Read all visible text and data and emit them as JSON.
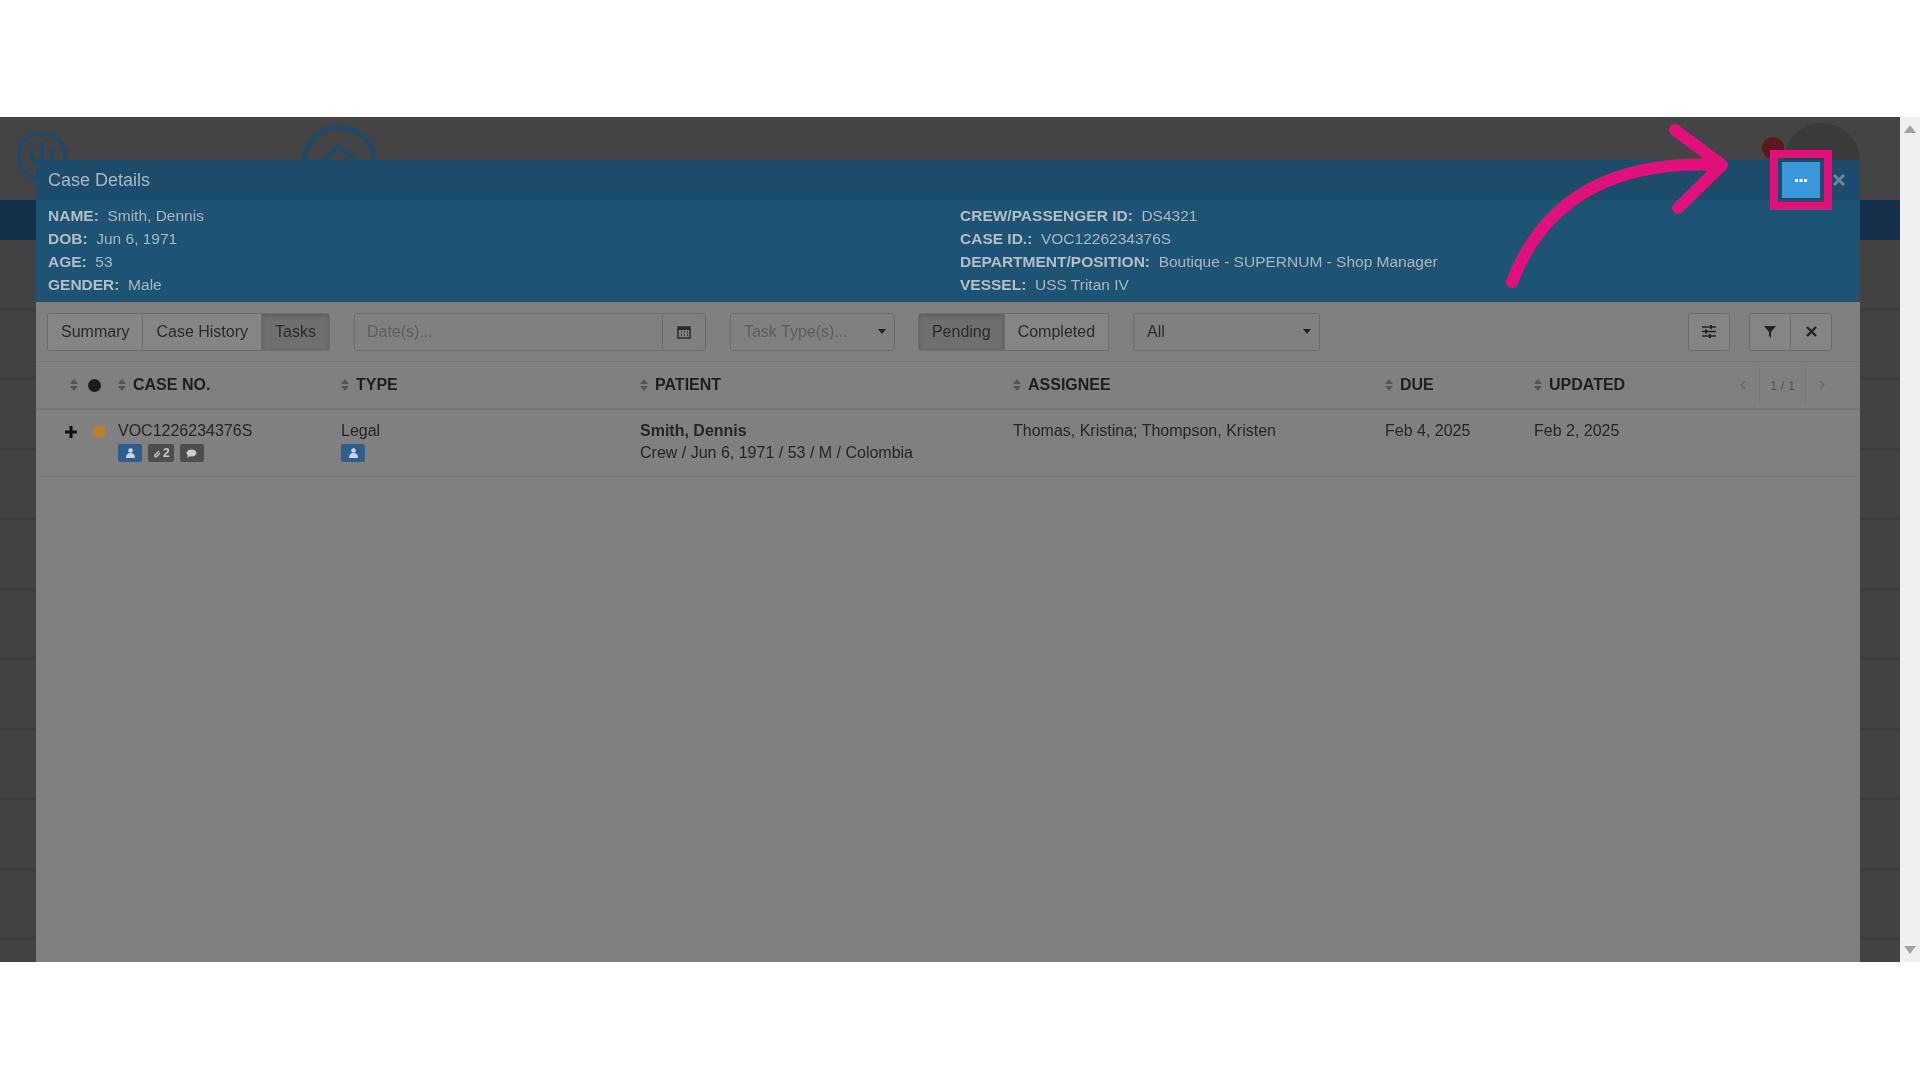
{
  "modal": {
    "title": "Case Details",
    "fields_left": [
      {
        "label": "NAME:",
        "value": "Smith, Dennis"
      },
      {
        "label": "DOB:",
        "value": "Jun 6, 1971"
      },
      {
        "label": "AGE:",
        "value": "53"
      },
      {
        "label": "GENDER:",
        "value": "Male"
      }
    ],
    "fields_right": [
      {
        "label": "CREW/PASSENGER ID:",
        "value": "DS4321"
      },
      {
        "label": "CASE ID.:",
        "value": "VOC1226234376S"
      },
      {
        "label": "DEPARTMENT/POSITION:",
        "value": "Boutique - SUPERNUM - Shop Manager"
      },
      {
        "label": "VESSEL:",
        "value": "USS Tritan IV"
      }
    ]
  },
  "view_tabs": [
    {
      "label": "Summary",
      "selected": false
    },
    {
      "label": "Case History",
      "selected": false
    },
    {
      "label": "Tasks",
      "selected": true
    }
  ],
  "date_filter": {
    "placeholder": "Date(s)..."
  },
  "task_type_filter": {
    "placeholder": "Task Type(s)..."
  },
  "status_tabs": [
    {
      "label": "Pending",
      "selected": true
    },
    {
      "label": "Completed",
      "selected": false
    }
  ],
  "assignee_filter": {
    "value": "All"
  },
  "pagination": "1 / 1",
  "table": {
    "columns": [
      "CASE NO.",
      "TYPE",
      "PATIENT",
      "ASSIGNEE",
      "DUE",
      "UPDATED"
    ],
    "rows": [
      {
        "case_no": "VOC1226234376S",
        "color": "#b5832f",
        "attachments": "2",
        "type": "Legal",
        "patient_name": "Smith, Dennis",
        "patient_details": "Crew / Jun 6, 1971 / 53 / M / Colombia",
        "assignee": "Thomas, Kristina; Thompson, Kristen",
        "due": "Feb 4, 2025",
        "updated": "Feb 2, 2025"
      }
    ]
  }
}
